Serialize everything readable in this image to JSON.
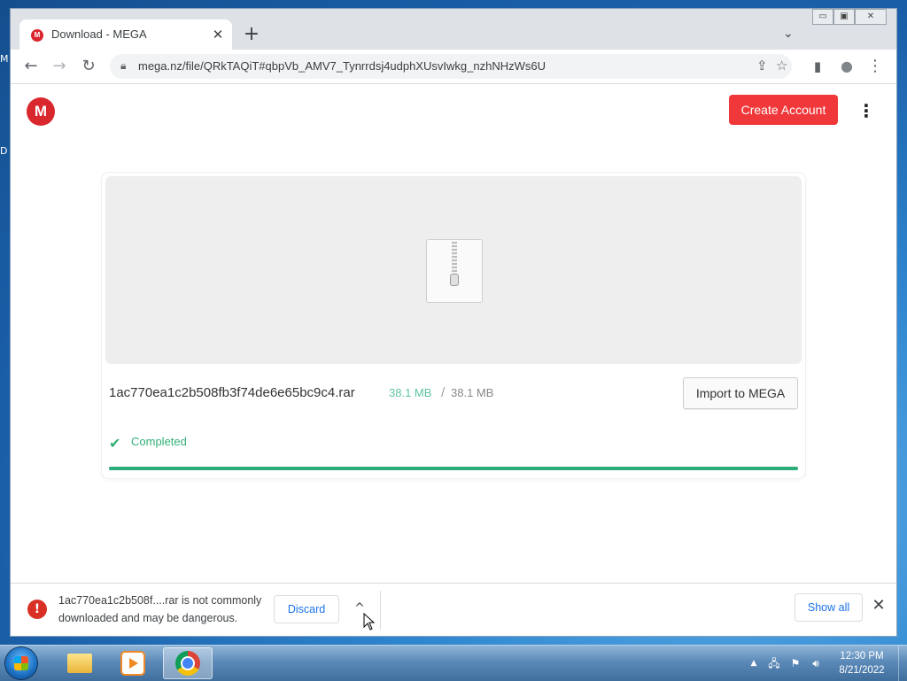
{
  "desktop": {
    "edge_letters": [
      "M",
      "D"
    ]
  },
  "window_controls": {
    "minimize": "▭",
    "maximize": "▣",
    "close": "✕"
  },
  "tab": {
    "title": "Download - MEGA",
    "favicon": "M",
    "close": "✕"
  },
  "tabstrip": {
    "new_tab": "+",
    "tab_search": "⌄"
  },
  "toolbar": {
    "back": "←",
    "forward": "→",
    "reload": "↻",
    "url": "mega.nz/file/QRkTAQiT#qbpVb_AMV7_Tynrrdsj4udphXUsvIwkg_nzhNHzWs6U",
    "share": "⇪",
    "bookmark": "☆",
    "side_panel": "▮",
    "profile": "●",
    "menu": "⋮"
  },
  "mega": {
    "logo": "M",
    "create_account": "Create Account",
    "menu": "⋮",
    "file_name": "1ac770ea1c2b508fb3f74de6e65bc9c4.rar",
    "size_downloaded": "38.1 MB",
    "size_separator": "/",
    "size_total": "38.1 MB",
    "import_button": "Import to MEGA",
    "status_icon": "✔",
    "status": "Completed",
    "progress": 1.0,
    "accent_color": "#2bad7a",
    "brand_color": "#d9272e"
  },
  "download_bar": {
    "warning_icon": "!",
    "warning_text": "1ac770ea1c2b508f....rar is not commonly downloaded and may be dangerous.",
    "discard": "Discard",
    "caret": "^",
    "show_all": "Show all",
    "close": "✕"
  },
  "taskbar": {
    "apps": [
      "folder-icon",
      "media-player-icon",
      "chrome-icon"
    ],
    "tray_expand": "▲",
    "clock_time": "12:30 PM",
    "clock_date": "8/21/2022"
  }
}
